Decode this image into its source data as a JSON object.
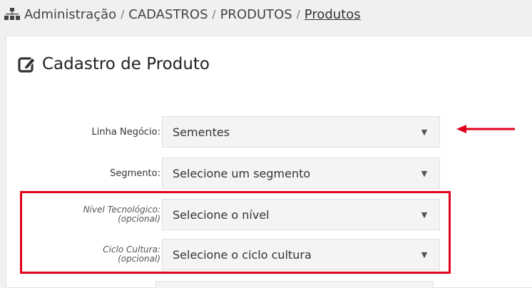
{
  "breadcrumb": {
    "items": [
      "Administração",
      "CADASTROS",
      "PRODUTOS"
    ],
    "current": "Produtos",
    "separator": "/"
  },
  "page": {
    "title": "Cadastro de Produto"
  },
  "form": {
    "linha_negocio": {
      "label": "Linha Negócio:",
      "value": "Sementes"
    },
    "segmento": {
      "label": "Segmento:",
      "value": "Selecione um segmento"
    },
    "nivel_tecnologico": {
      "label": "Nível Tecnológico:",
      "optional": "(opcional)",
      "value": "Selecione o nível"
    },
    "ciclo_cultura": {
      "label": "Ciclo Cultura:",
      "optional": "(opcional)",
      "value": "Selecione o ciclo cultura"
    }
  },
  "colors": {
    "annotation_red": "#e0001b",
    "background": "#f0f0f0",
    "panel": "#ffffff",
    "select_bg": "#f4f4f4"
  },
  "icons": [
    "sitemap-icon",
    "edit-icon",
    "caret-down-icon",
    "red-arrow-annotation"
  ]
}
